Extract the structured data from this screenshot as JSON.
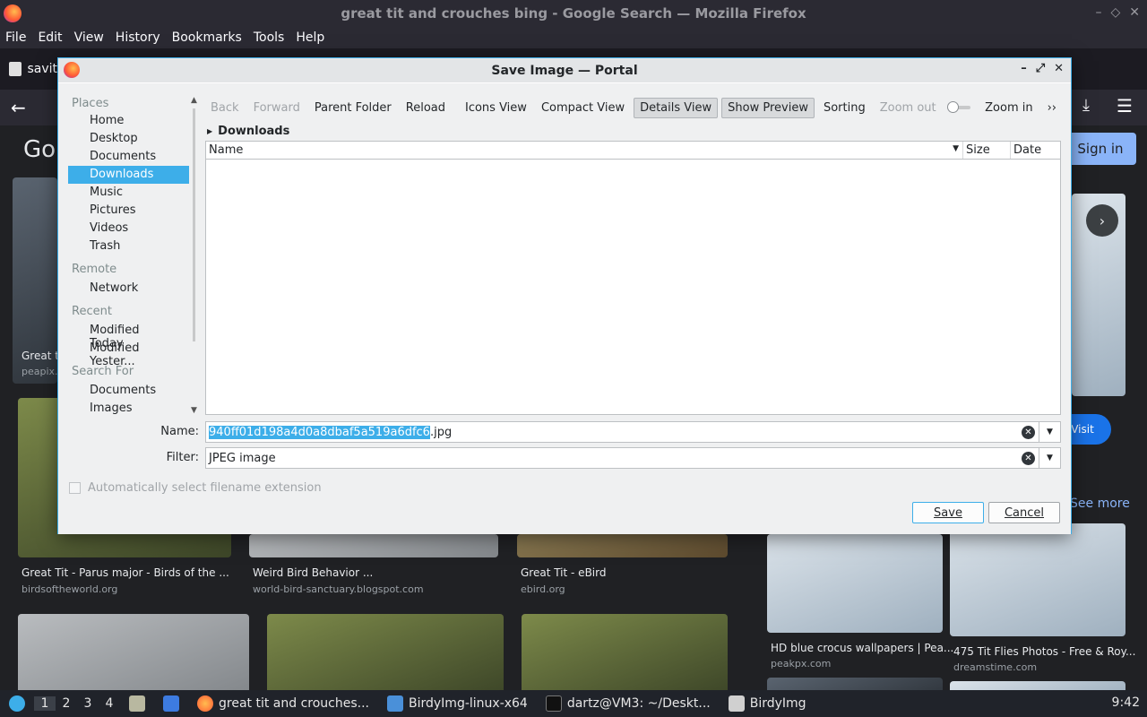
{
  "firefox": {
    "window_title": "great tit and crouches bing - Google Search — Mozilla Firefox",
    "menu": [
      "File",
      "Edit",
      "View",
      "History",
      "Bookmarks",
      "Tools",
      "Help"
    ],
    "tab_label": "savit"
  },
  "google": {
    "logo": "Go",
    "sign_in": "Sign in",
    "visit": "Visit",
    "see_more": "See more",
    "results": [
      {
        "caption": "Great ti",
        "source": "peapix.c"
      },
      {
        "caption": "Great Tit - Parus major - Birds of the ...",
        "source": "birdsoftheworld.org"
      },
      {
        "caption": "Weird Bird Behavior ...",
        "source": "world-bird-sanctuary.blogspot.com"
      },
      {
        "caption": "Great Tit - eBird",
        "source": "ebird.org"
      },
      {
        "caption": "HD blue crocus wallpapers | Pea...",
        "source": "peakpx.com"
      },
      {
        "caption": "475 Tit Flies Photos - Free & Roy...",
        "source": "dreamstime.com"
      }
    ]
  },
  "dialog": {
    "title": "Save Image — Portal",
    "places": {
      "sections": [
        {
          "heading": "Places",
          "items": [
            "Home",
            "Desktop",
            "Documents",
            "Downloads",
            "Music",
            "Pictures",
            "Videos",
            "Trash"
          ]
        },
        {
          "heading": "Remote",
          "items": [
            "Network"
          ]
        },
        {
          "heading": "Recent",
          "items": [
            "Modified Today",
            "Modified Yester..."
          ]
        },
        {
          "heading": "Search For",
          "items": [
            "Documents",
            "Images"
          ]
        }
      ],
      "selected": "Downloads"
    },
    "toolbar": {
      "back": "Back",
      "forward": "Forward",
      "parent": "Parent Folder",
      "reload": "Reload",
      "icons_view": "Icons View",
      "compact_view": "Compact View",
      "details_view": "Details View",
      "show_preview": "Show Preview",
      "sorting": "Sorting",
      "zoom_out": "Zoom out",
      "zoom_in": "Zoom in",
      "more": "››"
    },
    "breadcrumb": "Downloads",
    "columns": {
      "name": "Name",
      "size": "Size",
      "date": "Date"
    },
    "name_label": "Name:",
    "name_selected": "940ff01d198a4d0a8dbaf5a519a6dfc6",
    "name_ext": ".jpg",
    "filter_label": "Filter:",
    "filter_value": "JPEG image",
    "auto_ext": "Automatically select filename extension",
    "save": "Save",
    "cancel": "Cancel"
  },
  "taskbar": {
    "workspaces": [
      "1",
      "2",
      "3",
      "4"
    ],
    "items": [
      "great tit and crouches...",
      "BirdyImg-linux-x64",
      "dartz@VM3: ~/Deskt...",
      "BirdyImg"
    ],
    "clock": "9:42"
  }
}
